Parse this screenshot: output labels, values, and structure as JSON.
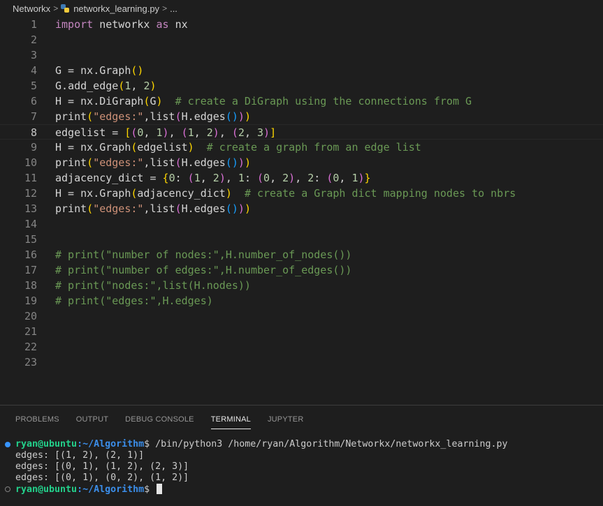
{
  "breadcrumb": {
    "folder": "Networkx",
    "file": "networkx_learning.py",
    "more": "..."
  },
  "editor": {
    "lines": [
      {
        "n": "1",
        "code": "import networkx as nx"
      },
      {
        "n": "2",
        "code": ""
      },
      {
        "n": "3",
        "code": ""
      },
      {
        "n": "4",
        "code": "G = nx.Graph()"
      },
      {
        "n": "5",
        "code": "G.add_edge(1, 2)"
      },
      {
        "n": "6",
        "code": "H = nx.DiGraph(G)  # create a DiGraph using the connections from G"
      },
      {
        "n": "7",
        "code": "print(\"edges:\",list(H.edges()))"
      },
      {
        "n": "8",
        "code": "edgelist = [(0, 1), (1, 2), (2, 3)]"
      },
      {
        "n": "9",
        "code": "H = nx.Graph(edgelist)  # create a graph from an edge list"
      },
      {
        "n": "10",
        "code": "print(\"edges:\",list(H.edges()))"
      },
      {
        "n": "11",
        "code": "adjacency_dict = {0: (1, 2), 1: (0, 2), 2: (0, 1)}"
      },
      {
        "n": "12",
        "code": "H = nx.Graph(adjacency_dict)  # create a Graph dict mapping nodes to nbrs"
      },
      {
        "n": "13",
        "code": "print(\"edges:\",list(H.edges()))"
      },
      {
        "n": "14",
        "code": ""
      },
      {
        "n": "15",
        "code": ""
      },
      {
        "n": "16",
        "code": "# print(\"number of nodes:\",H.number_of_nodes())"
      },
      {
        "n": "17",
        "code": "# print(\"number of edges:\",H.number_of_edges())"
      },
      {
        "n": "18",
        "code": "# print(\"nodes:\",list(H.nodes))"
      },
      {
        "n": "19",
        "code": "# print(\"edges:\",H.edges)"
      },
      {
        "n": "20",
        "code": ""
      },
      {
        "n": "21",
        "code": ""
      },
      {
        "n": "22",
        "code": ""
      },
      {
        "n": "23",
        "code": ""
      }
    ],
    "current_line": "8"
  },
  "panel": {
    "tabs": [
      "PROBLEMS",
      "OUTPUT",
      "DEBUG CONSOLE",
      "TERMINAL",
      "JUPYTER"
    ],
    "active_tab": "TERMINAL"
  },
  "terminal": {
    "user_host": "ryan@ubuntu",
    "cwd": ":~/Algorithm",
    "prompt_symbol": "$",
    "command": " /bin/python3 /home/ryan/Algorithm/Networkx/networkx_learning.py",
    "output": [
      "edges: [(1, 2), (2, 1)]",
      "edges: [(0, 1), (1, 2), (2, 3)]",
      "edges: [(0, 1), (0, 2), (1, 2)]"
    ]
  },
  "colors": {
    "background": "#1e1e1e",
    "keyword": "#c586c0",
    "string": "#ce9178",
    "number": "#b5cea8",
    "comment": "#6a9955",
    "terminal_user": "#23d18b",
    "terminal_path": "#3b8eea"
  },
  "icons": {
    "file_icon": "python-icon"
  }
}
